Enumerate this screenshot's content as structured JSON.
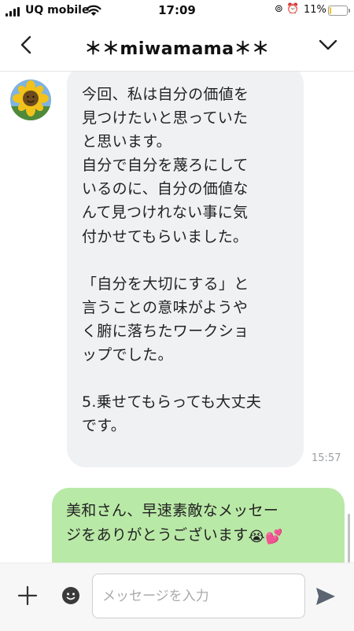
{
  "status_bar": {
    "carrier": "UQ mobile",
    "time": "17:09",
    "battery_percent": "11%",
    "battery_level": 0.11
  },
  "header": {
    "title": "＊＊miwamama＊＊"
  },
  "messages": [
    {
      "direction": "incoming",
      "text": "今回、私は自分の価値を\n見つけたいと思っていた\nと思います。\n自分で自分を蔑ろにして\nいるのに、自分の価値な\nんて見つけれない事に気\n付かせてもらいました。\n\n「自分を大切にする」と\n言うことの意味がようや\nく腑に落ちたワークショ\nップでした。\n\n5.乗せてもらっても大丈夫\nです。",
      "time": "15:57"
    },
    {
      "direction": "outgoing",
      "text_line1": "美和さん、早速素敵なメッセー",
      "text_line2": "ジをありがとうございます",
      "emojis": [
        "😭",
        "💕"
      ]
    }
  ],
  "composer": {
    "placeholder": "メッセージを入力"
  },
  "colors": {
    "incoming_bubble": "#f0f1f3",
    "outgoing_bubble": "#b9e9a7",
    "battery_low": "#f0c419"
  }
}
